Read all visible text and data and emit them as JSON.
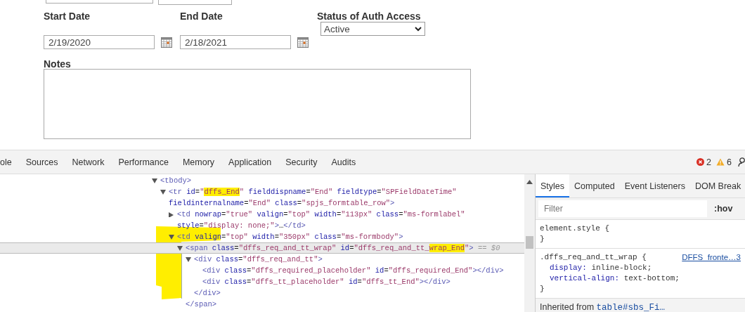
{
  "form": {
    "start_date": {
      "label": "Start Date",
      "value": "2/19/2020"
    },
    "end_date": {
      "label": "End Date",
      "value": "2/18/2021"
    },
    "status": {
      "label": "Status of Auth Access",
      "value": "Active"
    },
    "notes": {
      "label": "Notes"
    }
  },
  "devtools": {
    "tabs": [
      {
        "label": "ole",
        "selected": false
      },
      {
        "label": "Sources",
        "selected": false
      },
      {
        "label": "Network",
        "selected": false
      },
      {
        "label": "Performance",
        "selected": false
      },
      {
        "label": "Memory",
        "selected": false
      },
      {
        "label": "Application",
        "selected": false
      },
      {
        "label": "Security",
        "selected": false
      },
      {
        "label": "Audits",
        "selected": false
      }
    ],
    "errors": "2",
    "warnings": "6",
    "dom_tree": [
      {
        "expanded": true,
        "selected": false,
        "tokens": [
          {
            "kind": "tag",
            "text": "<tbody>"
          }
        ],
        "children": [
          {
            "expanded": true,
            "selected": false,
            "tokens": [
              {
                "kind": "tag",
                "text": "<tr"
              },
              {
                "kind": "attr",
                "text": " id"
              },
              {
                "kind": "plain",
                "text": "="
              },
              {
                "kind": "value",
                "text": "\""
              },
              {
                "kind": "value",
                "text": "dffs_End",
                "highlighted": true
              },
              {
                "kind": "value",
                "text": "\""
              },
              {
                "kind": "attr",
                "text": " fielddispname"
              },
              {
                "kind": "plain",
                "text": "="
              },
              {
                "kind": "value",
                "text": "\"End\""
              },
              {
                "kind": "attr",
                "text": " fieldtype"
              },
              {
                "kind": "plain",
                "text": "="
              },
              {
                "kind": "value",
                "text": "\"SPFieldDateTime\""
              },
              {
                "kind": "attr",
                "text": " fieldinternalname"
              },
              {
                "kind": "plain",
                "text": "="
              },
              {
                "kind": "value",
                "text": "\"End\""
              },
              {
                "kind": "attr",
                "text": " class"
              },
              {
                "kind": "plain",
                "text": "="
              },
              {
                "kind": "value",
                "text": "\"spjs_formtable_row\""
              },
              {
                "kind": "tag",
                "text": ">"
              }
            ],
            "children": [
              {
                "expanded": false,
                "selected": false,
                "tokens": [
                  {
                    "kind": "tag",
                    "text": "<td"
                  },
                  {
                    "kind": "attr",
                    "text": " nowrap"
                  },
                  {
                    "kind": "plain",
                    "text": "="
                  },
                  {
                    "kind": "value",
                    "text": "\"true\""
                  },
                  {
                    "kind": "attr",
                    "text": " valign"
                  },
                  {
                    "kind": "plain",
                    "text": "="
                  },
                  {
                    "kind": "value",
                    "text": "\"top\""
                  },
                  {
                    "kind": "attr",
                    "text": " width"
                  },
                  {
                    "kind": "plain",
                    "text": "="
                  },
                  {
                    "kind": "value",
                    "text": "\"113px\""
                  },
                  {
                    "kind": "attr",
                    "text": " class"
                  },
                  {
                    "kind": "plain",
                    "text": "="
                  },
                  {
                    "kind": "value",
                    "text": "\"ms-formlabel\""
                  },
                  {
                    "kind": "attr",
                    "text": " style"
                  },
                  {
                    "kind": "plain",
                    "text": "="
                  },
                  {
                    "kind": "value",
                    "text": "\"display: none;\""
                  },
                  {
                    "kind": "tag",
                    "text": ">"
                  },
                  {
                    "kind": "plain",
                    "text": "…"
                  },
                  {
                    "kind": "tag",
                    "text": "</td>"
                  }
                ]
              },
              {
                "expanded": true,
                "selected": false,
                "tokens": [
                  {
                    "kind": "tag",
                    "text": "<td"
                  },
                  {
                    "kind": "attr",
                    "text": " valign"
                  },
                  {
                    "kind": "plain",
                    "text": "="
                  },
                  {
                    "kind": "value",
                    "text": "\"top\""
                  },
                  {
                    "kind": "attr",
                    "text": " width"
                  },
                  {
                    "kind": "plain",
                    "text": "="
                  },
                  {
                    "kind": "value",
                    "text": "\"350px\""
                  },
                  {
                    "kind": "attr",
                    "text": " class"
                  },
                  {
                    "kind": "plain",
                    "text": "="
                  },
                  {
                    "kind": "value",
                    "text": "\"ms-formbody\""
                  },
                  {
                    "kind": "tag",
                    "text": ">"
                  }
                ],
                "children": [
                  {
                    "expanded": true,
                    "selected": true,
                    "close": "</span>",
                    "tokens": [
                      {
                        "kind": "tag",
                        "text": "<span"
                      },
                      {
                        "kind": "attr",
                        "text": " class"
                      },
                      {
                        "kind": "plain",
                        "text": "="
                      },
                      {
                        "kind": "value",
                        "text": "\"dffs_req_and_tt_wrap\""
                      },
                      {
                        "kind": "attr",
                        "text": " id"
                      },
                      {
                        "kind": "plain",
                        "text": "="
                      },
                      {
                        "kind": "value",
                        "text": "\"dffs_req_and_tt_"
                      },
                      {
                        "kind": "value",
                        "text": "wrap_End",
                        "highlighted": true
                      },
                      {
                        "kind": "value",
                        "text": "\""
                      },
                      {
                        "kind": "tag",
                        "text": ">"
                      },
                      {
                        "kind": "console",
                        "text": " == $0"
                      }
                    ],
                    "children": [
                      {
                        "expanded": true,
                        "selected": false,
                        "close": "</div>",
                        "tokens": [
                          {
                            "kind": "tag",
                            "text": "<div"
                          },
                          {
                            "kind": "attr",
                            "text": " class"
                          },
                          {
                            "kind": "plain",
                            "text": "="
                          },
                          {
                            "kind": "value",
                            "text": "\"dffs_req_and_tt\""
                          },
                          {
                            "kind": "tag",
                            "text": ">"
                          }
                        ],
                        "children": [
                          {
                            "selected": false,
                            "tokens": [
                              {
                                "kind": "tag",
                                "text": "<div"
                              },
                              {
                                "kind": "attr",
                                "text": " class"
                              },
                              {
                                "kind": "plain",
                                "text": "="
                              },
                              {
                                "kind": "value",
                                "text": "\"dffs_required_placeholder\""
                              },
                              {
                                "kind": "attr",
                                "text": " id"
                              },
                              {
                                "kind": "plain",
                                "text": "="
                              },
                              {
                                "kind": "value",
                                "text": "\"dffs_required_End\""
                              },
                              {
                                "kind": "tag",
                                "text": "></div>"
                              }
                            ]
                          },
                          {
                            "selected": false,
                            "tokens": [
                              {
                                "kind": "tag",
                                "text": "<div"
                              },
                              {
                                "kind": "attr",
                                "text": " class"
                              },
                              {
                                "kind": "plain",
                                "text": "="
                              },
                              {
                                "kind": "value",
                                "text": "\"dffs_tt_placeholder\""
                              },
                              {
                                "kind": "attr",
                                "text": " id"
                              },
                              {
                                "kind": "plain",
                                "text": "="
                              },
                              {
                                "kind": "value",
                                "text": "\"dffs_tt_End\""
                              },
                              {
                                "kind": "tag",
                                "text": "></div>"
                              }
                            ]
                          }
                        ]
                      }
                    ]
                  }
                ]
              }
            ]
          }
        ]
      }
    ],
    "sidebar": {
      "tabs": [
        {
          "label": "Styles",
          "selected": true
        },
        {
          "label": "Computed",
          "selected": false
        },
        {
          "label": "Event Listeners",
          "selected": false
        },
        {
          "label": "DOM Break",
          "selected": false
        }
      ],
      "filter": {
        "placeholder": "Filter"
      },
      "hov": ":hov",
      "rules": [
        {
          "selector": "element.style {",
          "close": "}"
        },
        {
          "selector": ".dffs_req_and_tt_wrap {",
          "source": "DFFS_fronte…3",
          "properties": [
            {
              "name": "display:",
              "value": "inline-block;"
            },
            {
              "name": "vertical-align:",
              "value": "text-bottom;"
            }
          ],
          "close": "}"
        }
      ],
      "inherited_label": "Inherited from",
      "inherited_link": "table#sbs_Fi…"
    }
  }
}
